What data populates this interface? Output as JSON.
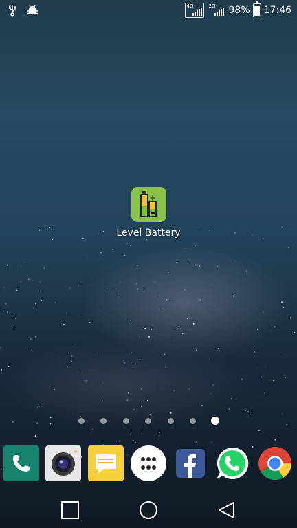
{
  "status_bar": {
    "left_icons": [
      "usb-icon",
      "android-debug-icon"
    ],
    "network_1": "4G",
    "network_2": "2G",
    "battery_percent": "98%",
    "battery_level": 0.98,
    "time": "17:46"
  },
  "home_screen": {
    "app": {
      "label": "Level Battery",
      "icon": "battery-app-icon"
    }
  },
  "pager": {
    "page_count": 7,
    "active_index": 6
  },
  "dock": {
    "items": [
      {
        "name": "phone",
        "icon": "phone-icon"
      },
      {
        "name": "camera",
        "icon": "camera-icon"
      },
      {
        "name": "messaging",
        "icon": "message-icon"
      },
      {
        "name": "apps",
        "icon": "apps-grid-icon"
      },
      {
        "name": "facebook",
        "icon": "facebook-icon"
      },
      {
        "name": "whatsapp",
        "icon": "whatsapp-icon"
      },
      {
        "name": "chrome",
        "icon": "chrome-icon"
      }
    ]
  },
  "nav_bar": {
    "buttons": [
      "recents-button",
      "home-button",
      "back-button"
    ]
  },
  "colors": {
    "app_icon_bg": "#8bc34a",
    "phone": "#16826e",
    "messaging": "#f7d03e",
    "facebook": "#3b5998",
    "whatsapp": "#25d366"
  }
}
